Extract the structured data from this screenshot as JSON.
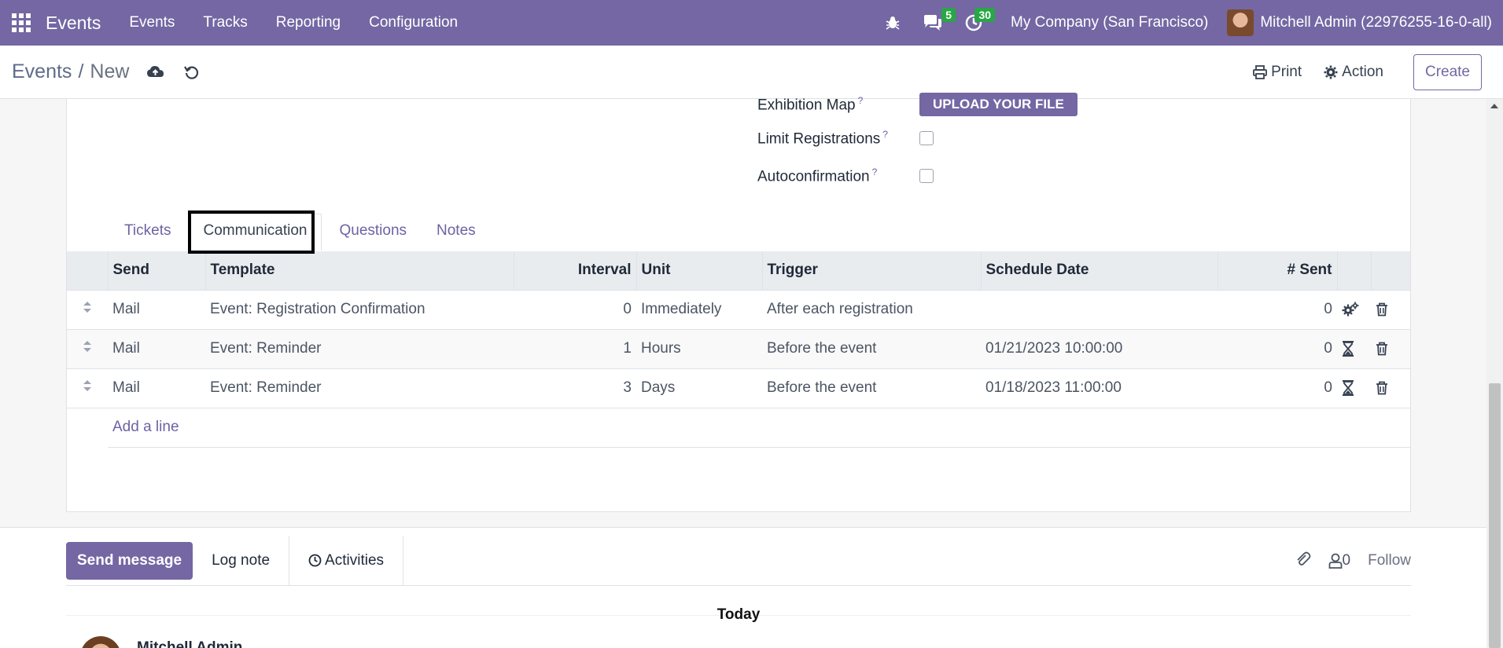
{
  "navbar": {
    "brand": "Events",
    "menu": [
      "Events",
      "Tracks",
      "Reporting",
      "Configuration"
    ],
    "messages_count": "5",
    "activities_count": "30",
    "company": "My Company (San Francisco)",
    "user": "Mitchell Admin (22976255-16-0-all)"
  },
  "control_panel": {
    "breadcrumb_root": "Events",
    "breadcrumb_sep": "/",
    "breadcrumb_current": "New",
    "print_label": "Print",
    "action_label": "Action",
    "create_label": "Create"
  },
  "form": {
    "exhibition_map_label": "Exhibition Map",
    "upload_label": "Upload your file",
    "limit_registrations_label": "Limit Registrations",
    "autoconfirmation_label": "Autoconfirmation",
    "help_mark": "?"
  },
  "tabs": [
    "Tickets",
    "Communication",
    "Questions",
    "Notes"
  ],
  "table": {
    "headers": {
      "send": "Send",
      "template": "Template",
      "interval": "Interval",
      "unit": "Unit",
      "trigger": "Trigger",
      "schedule_date": "Schedule Date",
      "sent": "# Sent"
    },
    "rows": [
      {
        "send": "Mail",
        "template": "Event: Registration Confirmation",
        "interval": "0",
        "unit": "Immediately",
        "trigger": "After each registration",
        "schedule_date": "",
        "sent": "0",
        "status_icon": "gears-icon"
      },
      {
        "send": "Mail",
        "template": "Event: Reminder",
        "interval": "1",
        "unit": "Hours",
        "trigger": "Before the event",
        "schedule_date": "01/21/2023 10:00:00",
        "sent": "0",
        "status_icon": "hourglass-icon"
      },
      {
        "send": "Mail",
        "template": "Event: Reminder",
        "interval": "3",
        "unit": "Days",
        "trigger": "Before the event",
        "schedule_date": "01/18/2023 11:00:00",
        "sent": "0",
        "status_icon": "hourglass-icon"
      }
    ],
    "add_line": "Add a line"
  },
  "chatter": {
    "send_message": "Send message",
    "log_note": "Log note",
    "activities": "Activities",
    "followers_count": "0",
    "follow": "Follow",
    "today": "Today",
    "author": "Mitchell Admin"
  },
  "colors": {
    "brand": "#7467a3",
    "badge": "#28a745",
    "link": "#6c63a3"
  }
}
